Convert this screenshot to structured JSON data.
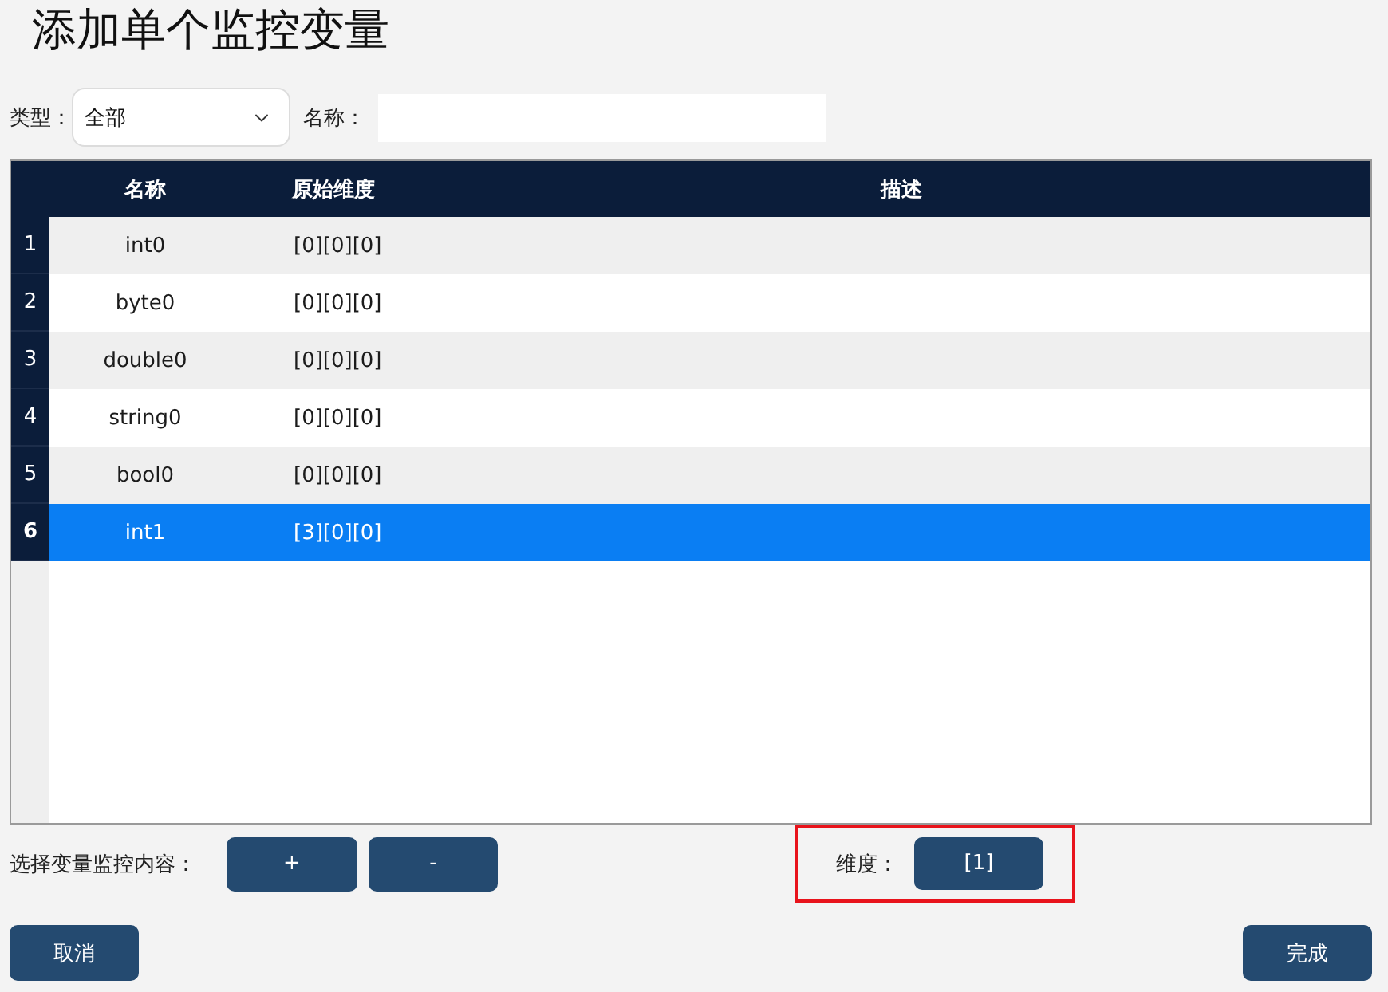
{
  "title": "添加单个监控变量",
  "filters": {
    "type_label": "类型：",
    "type_value": "全部",
    "name_label": "名称："
  },
  "table": {
    "columns": [
      "名称",
      "原始维度",
      "描述"
    ],
    "rows": [
      {
        "number": "1",
        "name": "int0",
        "dims": "[0][0][0]",
        "selected": false
      },
      {
        "number": "2",
        "name": "byte0",
        "dims": "[0][0][0]",
        "selected": false
      },
      {
        "number": "3",
        "name": "double0",
        "dims": "[0][0][0]",
        "selected": false
      },
      {
        "number": "4",
        "name": "string0",
        "dims": "[0][0][0]",
        "selected": false
      },
      {
        "number": "5",
        "name": "bool0",
        "dims": "[0][0][0]",
        "selected": false
      },
      {
        "number": "6",
        "name": "int1",
        "dims": "[3][0][0]",
        "selected": true
      }
    ]
  },
  "monitor": {
    "label": "选择变量监控内容：",
    "add_button": "+",
    "remove_button": "-"
  },
  "dimension": {
    "label": "维度：",
    "value": "[1]",
    "highlighted": true
  },
  "actions": {
    "cancel": "取消",
    "done": "完成"
  }
}
